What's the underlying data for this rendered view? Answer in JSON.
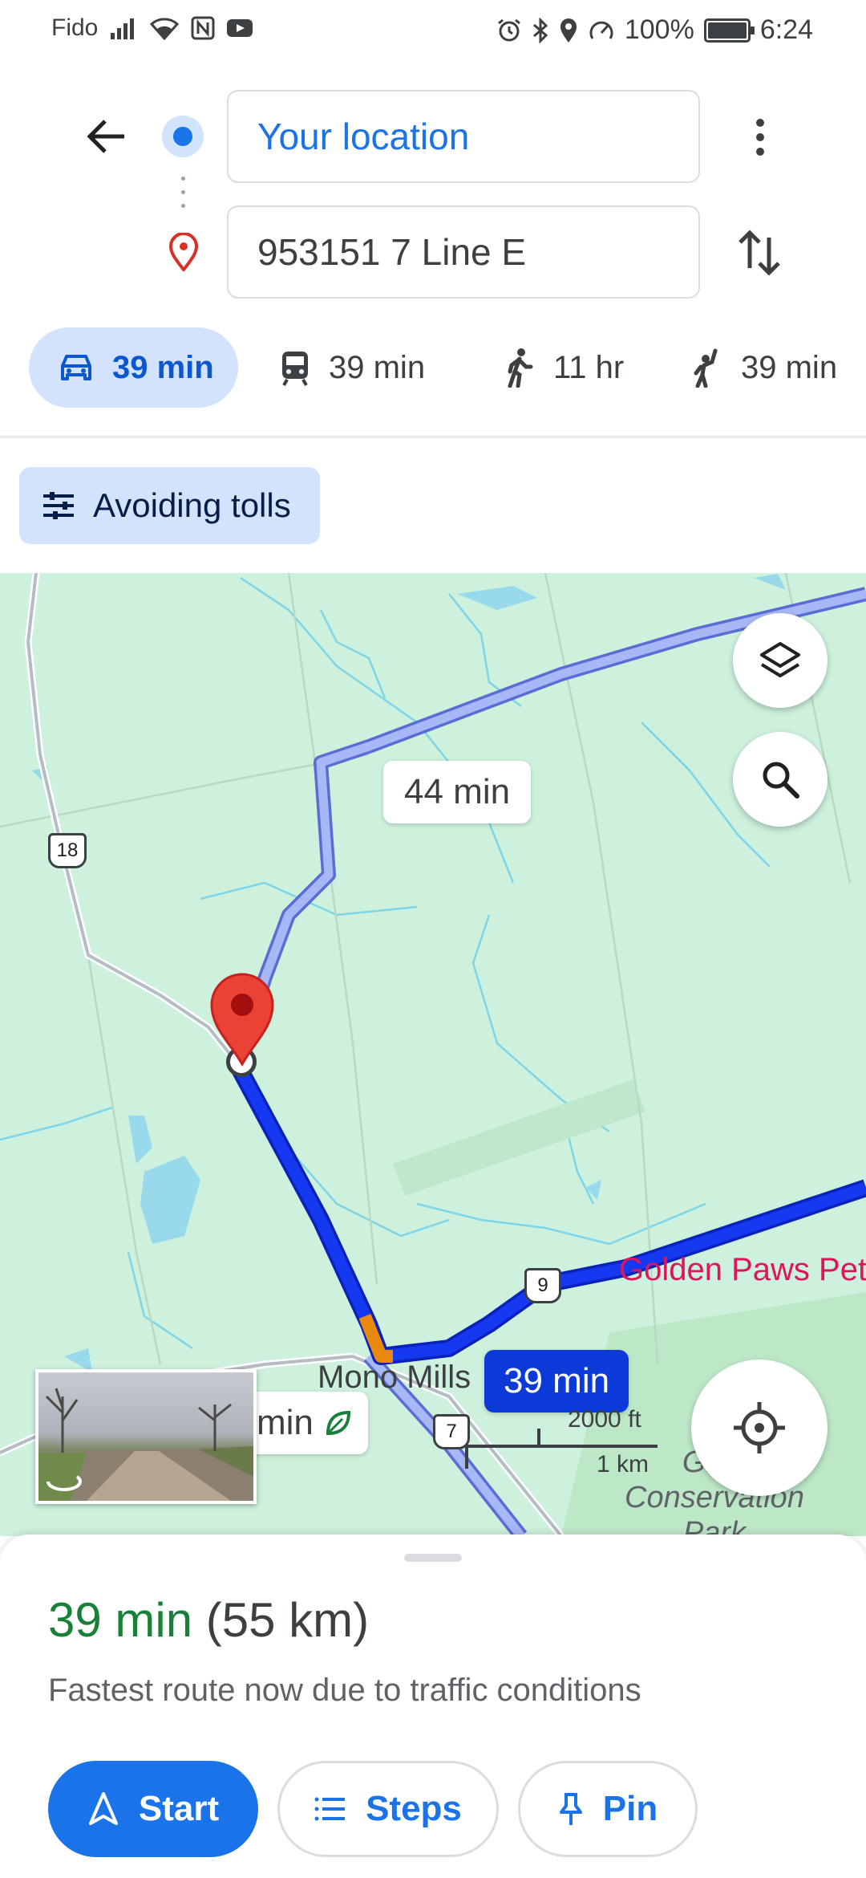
{
  "status_bar": {
    "carrier": "Fido",
    "battery": "100%",
    "time": "6:24",
    "icons": [
      "signal-icon",
      "wifi-icon",
      "nfc-icon",
      "youtube-icon",
      "alarm-icon",
      "bluetooth-icon",
      "location-icon",
      "data-saver-icon",
      "battery-icon"
    ]
  },
  "directions": {
    "origin": "Your location",
    "destination": "953151 7 Line E"
  },
  "modes": [
    {
      "name": "drive",
      "label": "39 min",
      "icon": "car-icon",
      "active": true
    },
    {
      "name": "transit",
      "label": "39 min",
      "icon": "train-icon",
      "active": false
    },
    {
      "name": "walk",
      "label": "11 hr",
      "icon": "walk-icon",
      "active": false
    },
    {
      "name": "ride",
      "label": "39 min",
      "icon": "hail-icon",
      "active": false
    }
  ],
  "options_chip": {
    "label": "Avoiding tolls",
    "icon": "tune-icon"
  },
  "map": {
    "alt_route_label": "44 min",
    "selected_route_label": "39 min",
    "eco_route_label": "min",
    "poi_label": "Golden Paws Pet",
    "town_label": "Mono Mills",
    "park_label": "Glen Conservation Park",
    "road_shields": [
      "18",
      "9",
      "7"
    ],
    "scale_ft": "2000 ft",
    "scale_km": "1 km"
  },
  "summary": {
    "duration": "39 min",
    "distance": "(55 km)",
    "note": "Fastest route now due to traffic conditions"
  },
  "actions": {
    "start": "Start",
    "steps": "Steps",
    "pin": "Pin"
  },
  "colors": {
    "accent": "#1a73e8",
    "route": "#0b3ad8",
    "alt_route": "#a8b7f5",
    "traffic": "#e8890c",
    "duration": "#188038",
    "pin": "#ea4335"
  }
}
